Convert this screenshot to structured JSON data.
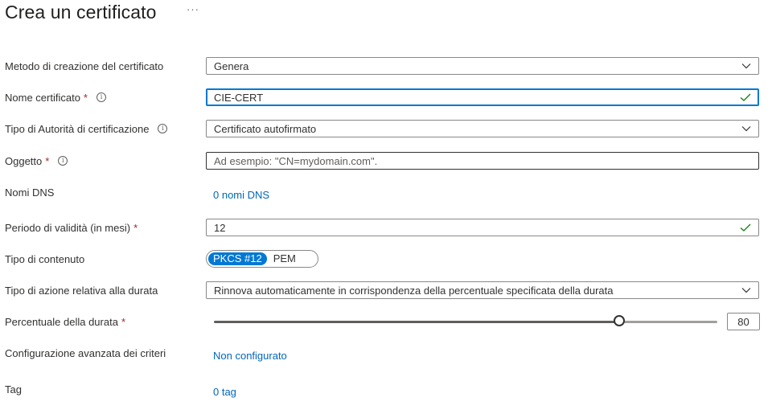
{
  "header": {
    "title": "Crea un certificato",
    "more_label": "···"
  },
  "form": {
    "method": {
      "label": "Metodo di creazione del certificato",
      "value": "Genera"
    },
    "name": {
      "label": "Nome certificato",
      "required_mark": "*",
      "value": "CIE-CERT"
    },
    "ca_type": {
      "label": "Tipo di Autorità di certificazione",
      "value": "Certificato autofirmato"
    },
    "subject": {
      "label": "Oggetto",
      "required_mark": "*",
      "placeholder": "Ad esempio: \"CN=mydomain.com\"."
    },
    "dns": {
      "label": "Nomi DNS",
      "link": "0 nomi DNS"
    },
    "validity": {
      "label": "Periodo di validità (in mesi)",
      "required_mark": "*",
      "value": "12"
    },
    "content_type": {
      "label": "Tipo di contenuto",
      "options": [
        "PKCS #12",
        "PEM"
      ],
      "selected": "PKCS #12"
    },
    "lifetime_action": {
      "label": "Tipo di azione relativa alla durata",
      "value": "Rinnova automaticamente in corrispondenza della percentuale specificata della durata"
    },
    "lifetime_percentage": {
      "label": "Percentuale della durata",
      "required_mark": "*",
      "value": "80",
      "slider_fraction": 0.8
    },
    "advanced_policy": {
      "label": "Configurazione avanzata dei criteri",
      "link": "Non configurato"
    },
    "tags": {
      "label": "Tag",
      "link": "0 tag"
    }
  },
  "colors": {
    "accent": "#0078d4",
    "link": "#0067b8",
    "required": "#a4262c",
    "valid": "#107c10"
  }
}
